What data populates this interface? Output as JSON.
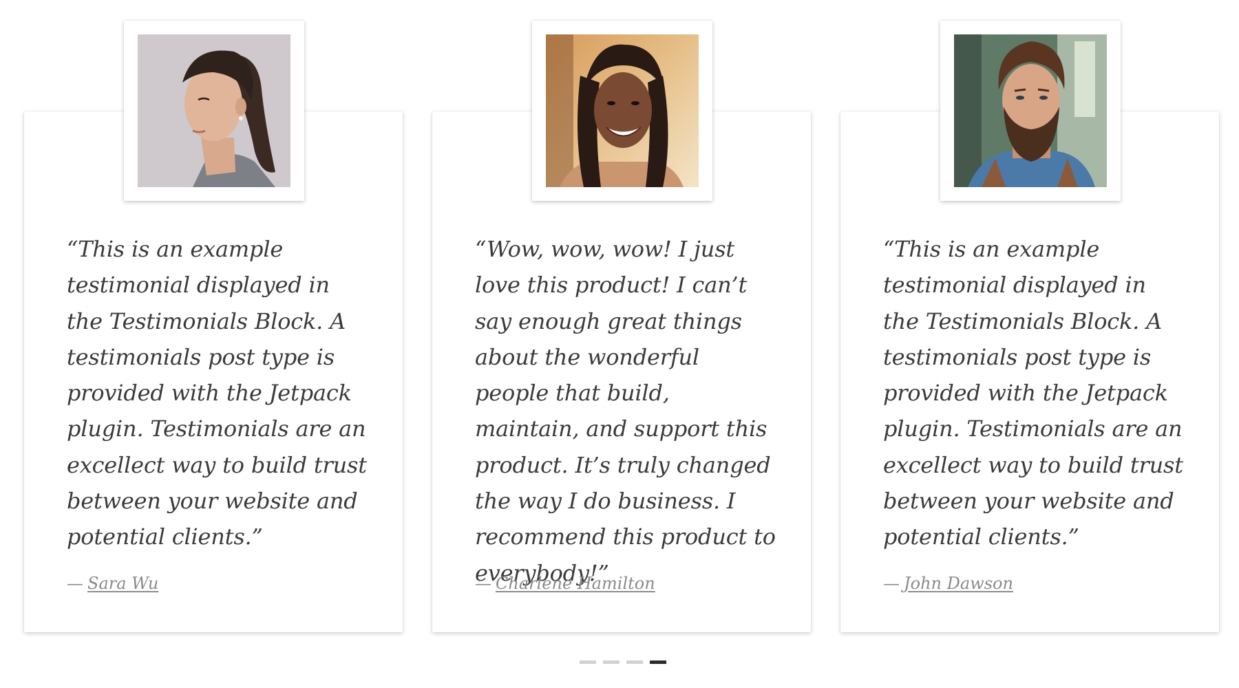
{
  "testimonials": [
    {
      "quote": "“This is an example testimonial displayed in the Testimonials Block. A testimonials post type is provided with the Jetpack plugin. Testimonials are an excellect way to build trust between your website and potential clients.”",
      "dash": "—",
      "author": "Sara Wu",
      "photo_icon": "portrait-woman-ponytail"
    },
    {
      "quote": "“Wow, wow, wow! I just love this product! I can’t say enough great things about the wonderful people that build, maintain, and support this product. It’s truly changed the way I do business. I recommend this product to everybody!”",
      "dash": "—",
      "author": "Charlene Hamilton",
      "photo_icon": "portrait-woman-braids-smiling"
    },
    {
      "quote": "“This is an example testimonial displayed in the Testimonials Block. A testimonials post type is provided with the Jetpack plugin. Testimonials are an excellect way to build trust between your website and potential clients.”",
      "dash": "—",
      "author": "John Dawson",
      "photo_icon": "portrait-man-beard"
    }
  ],
  "pagination": {
    "total": 4,
    "active_index": 3
  },
  "colors": {
    "text": "#3b3b3b",
    "author": "#8a8a8a",
    "dot_inactive": "#d2d2d2",
    "dot_active": "#2b2b2b"
  }
}
